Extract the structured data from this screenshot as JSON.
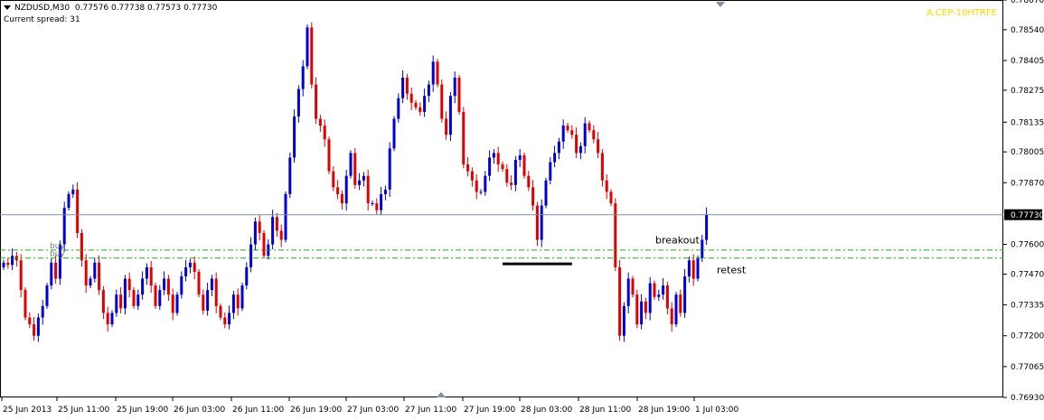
{
  "header": {
    "symbol": "NZDUSD,M30",
    "ohlc": "0.77576 0.77738 0.77573 0.77730",
    "spread_label": "Current spread: 31",
    "brand": "A.CEP-10HTRFE"
  },
  "colors": {
    "bull": "#0000d6",
    "bear": "#e00000",
    "price_line": "#7d8fa0",
    "order_line": "#22aa22",
    "axis": "#000000"
  },
  "chart_data": {
    "type": "candlestick",
    "title": "NZDUSD,M30",
    "ylim": [
      0.7693,
      0.7867
    ],
    "y_ticks": [
      "0.78670",
      "0.78540",
      "0.78405",
      "0.78275",
      "0.78135",
      "0.78005",
      "0.77870",
      "0.77600",
      "0.77470",
      "0.77335",
      "0.77200",
      "0.77065",
      "0.76930"
    ],
    "x_ticks": [
      "25 Jun 2013",
      "25 Jun 11:00",
      "25 Jun 19:00",
      "26 Jun 03:00",
      "26 Jun 11:00",
      "26 Jun 19:00",
      "27 Jun 03:00",
      "27 Jun 11:00",
      "27 Jun 19:00",
      "28 Jun 03:00",
      "28 Jun 11:00",
      "28 Jun 19:00",
      "1 Jul 03:00"
    ],
    "current_price": "0.77730",
    "order_lines": [
      {
        "label": "buy",
        "price": 0.77575
      },
      {
        "label": "buy",
        "price": 0.7754
      }
    ],
    "annotations": [
      {
        "text": "breakout",
        "price": 0.7762
      },
      {
        "text": "retest",
        "price": 0.7749
      }
    ],
    "resistance_line": {
      "price": 0.77515,
      "from_bar": 115,
      "to_bar": 131
    },
    "series": [
      {
        "name": "close",
        "values": [
          0.7752,
          0.7751,
          0.7755,
          0.7753,
          0.774,
          0.7728,
          0.7725,
          0.772,
          0.7728,
          0.7733,
          0.7742,
          0.7752,
          0.7745,
          0.776,
          0.7776,
          0.7782,
          0.7784,
          0.7765,
          0.7753,
          0.7742,
          0.7745,
          0.7752,
          0.774,
          0.773,
          0.7725,
          0.773,
          0.7738,
          0.7732,
          0.7745,
          0.774,
          0.7733,
          0.7738,
          0.7745,
          0.775,
          0.7742,
          0.7733,
          0.774,
          0.7745,
          0.7738,
          0.773,
          0.7738,
          0.7746,
          0.775,
          0.7752,
          0.7748,
          0.7738,
          0.7731,
          0.774,
          0.7745,
          0.7733,
          0.7728,
          0.7725,
          0.773,
          0.7738,
          0.7732,
          0.7742,
          0.775,
          0.776,
          0.777,
          0.7765,
          0.7755,
          0.776,
          0.7772,
          0.7766,
          0.7762,
          0.7782,
          0.7798,
          0.7816,
          0.7828,
          0.7838,
          0.7855,
          0.783,
          0.7815,
          0.7812,
          0.7806,
          0.7792,
          0.7785,
          0.7782,
          0.7778,
          0.779,
          0.78,
          0.7786,
          0.7788,
          0.779,
          0.7778,
          0.7778,
          0.7775,
          0.7782,
          0.7784,
          0.7802,
          0.7815,
          0.7824,
          0.7833,
          0.7826,
          0.7822,
          0.782,
          0.7818,
          0.7825,
          0.783,
          0.784,
          0.783,
          0.7815,
          0.7808,
          0.7825,
          0.7833,
          0.7818,
          0.7795,
          0.7792,
          0.7788,
          0.7783,
          0.7783,
          0.779,
          0.7798,
          0.78,
          0.7795,
          0.7793,
          0.7787,
          0.7786,
          0.7797,
          0.7799,
          0.779,
          0.7785,
          0.7777,
          0.7762,
          0.7777,
          0.7788,
          0.7796,
          0.78,
          0.7805,
          0.7812,
          0.781,
          0.7808,
          0.78,
          0.7803,
          0.7813,
          0.781,
          0.7806,
          0.78,
          0.7788,
          0.7783,
          0.7778,
          0.775,
          0.772,
          0.7733,
          0.7745,
          0.7738,
          0.7725,
          0.7735,
          0.773,
          0.7743,
          0.7737,
          0.7738,
          0.7742,
          0.7732,
          0.7725,
          0.7738,
          0.773,
          0.7746,
          0.7753,
          0.7745,
          0.7754,
          0.7762,
          0.7773
        ]
      }
    ]
  }
}
